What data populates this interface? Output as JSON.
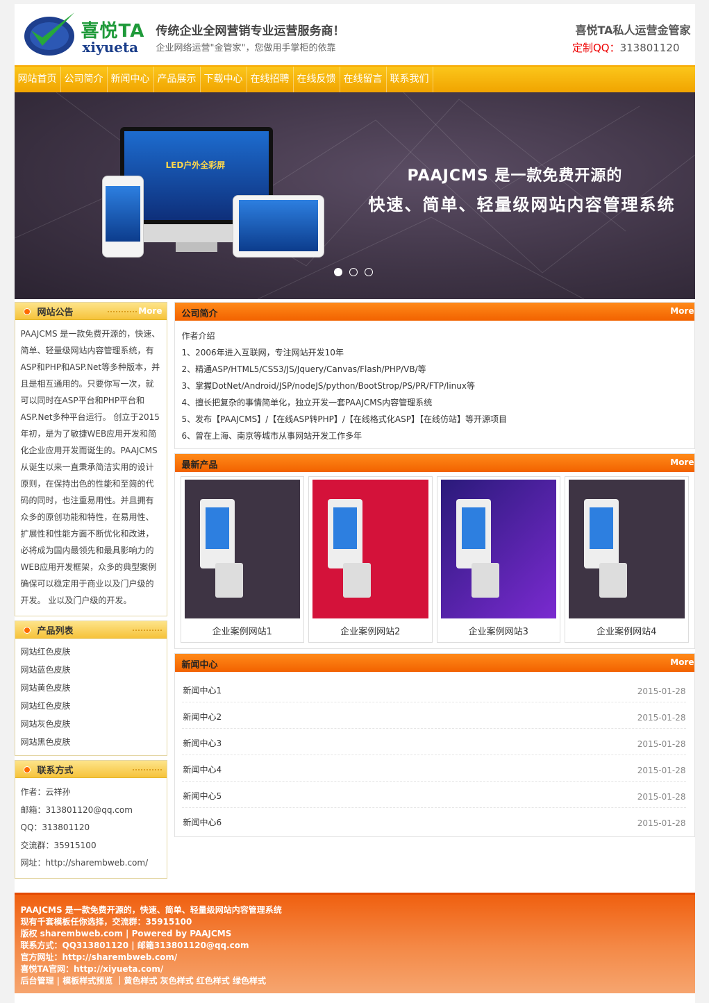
{
  "header": {
    "logo_cn": "喜悦TA",
    "logo_en": "xiyueta",
    "slogan": "传统企业全网营销专业运营服务商！",
    "subslogan": "企业网络运营\"金管家\"，您做用手掌柜的依靠",
    "contact_title": "喜悦TA私人运营金管家",
    "contact_label": "定制QQ：",
    "contact_qq": "313801120"
  },
  "nav": [
    "网站首页",
    "公司简介",
    "新闻中心",
    "产品展示",
    "下载中心",
    "在线招聘",
    "在线反馈",
    "在线留言",
    "联系我们"
  ],
  "banner": {
    "line1": "PAAJCMS 是一款免费开源的",
    "line2": "快速、简单、轻量级网站内容管理系统",
    "screen_text": "LED户外全彩屏"
  },
  "notice": {
    "title": "网站公告",
    "more": "More",
    "text": "PAAJCMS 是一款免费开源的，快速、简单、轻量级网站内容管理系统，有ASP和PHP和ASP.Net等多种版本，并且是相互通用的。只要你写一次，就可以同时在ASP平台和PHP平台和ASP.Net多种平台运行。 创立于2015年初，是为了敏捷WEB应用开发和简化企业应用开发而诞生的。PAAJCMS从诞生以来一直秉承简洁实用的设计原则，在保持出色的性能和至简的代码的同时，也注重易用性。并且拥有众多的原创功能和特性，在易用性、扩展性和性能方面不断优化和改进，必将成为国内最领先和最具影响力的WEB应用开发框架，众多的典型案例确保可以稳定用于商业以及门户级的开发。 业以及门户级的开发。"
  },
  "product_list": {
    "title": "产品列表",
    "items": [
      "网站红色皮肤",
      "网站蓝色皮肤",
      "网站黄色皮肤",
      "网站红色皮肤",
      "网站灰色皮肤",
      "网站黑色皮肤"
    ]
  },
  "contact": {
    "title": "联系方式",
    "items": [
      "作者：云祥孙",
      "邮箱：313801120@qq.com",
      "QQ：313801120",
      "交流群：35915100",
      "网址：http://sharembweb.com/"
    ]
  },
  "company": {
    "title": "公司简介",
    "more": "More",
    "items": [
      "作者介绍",
      "1、2006年进入互联网，专注网站开发10年",
      "2、精通ASP/HTML5/CSS3/JS/Jquery/Canvas/Flash/PHP/VB/等",
      "3、掌握DotNet/Android/JSP/nodeJS/python/BootStrop/PS/PR/FTP/linux等",
      "4、擅长把复杂的事情简单化，独立开发一套PAAJCMS内容管理系统",
      "5、发布【PAAJCMS】/【在线ASP转PHP】/【在线格式化ASP】【在线仿站】等开源项目",
      "6、曾在上海、南京等城市从事网站开发工作多年"
    ]
  },
  "products": {
    "title": "最新产品",
    "more": "More",
    "items": [
      {
        "name": "企业案例网站1",
        "bg": "#3e3444"
      },
      {
        "name": "企业案例网站2",
        "bg": "#d4123a"
      },
      {
        "name": "企业案例网站3",
        "bg": "#3a1f8a"
      },
      {
        "name": "企业案例网站4",
        "bg": "#3e3444"
      }
    ]
  },
  "news": {
    "title": "新闻中心",
    "more": "More",
    "items": [
      {
        "title": "新闻中心1",
        "date": "2015-01-28"
      },
      {
        "title": "新闻中心2",
        "date": "2015-01-28"
      },
      {
        "title": "新闻中心3",
        "date": "2015-01-28"
      },
      {
        "title": "新闻中心4",
        "date": "2015-01-28"
      },
      {
        "title": "新闻中心5",
        "date": "2015-01-28"
      },
      {
        "title": "新闻中心6",
        "date": "2015-01-28"
      }
    ]
  },
  "footer": [
    "PAAJCMS 是一款免费开源的，快速、简单、轻量级网站内容管理系统",
    "现有千套模板任你选择，交流群：35915100",
    "版权 sharembweb.com | Powered by PAAJCMS",
    "联系方式：QQ313801120 | 邮箱313801120@qq.com",
    "官方网址：http://sharembweb.com/",
    "喜悦TA官网：http://xiyueta.com/",
    "后台管理 | 模板样式预览 ｜黄色样式 灰色样式 红色样式 绿色样式"
  ]
}
